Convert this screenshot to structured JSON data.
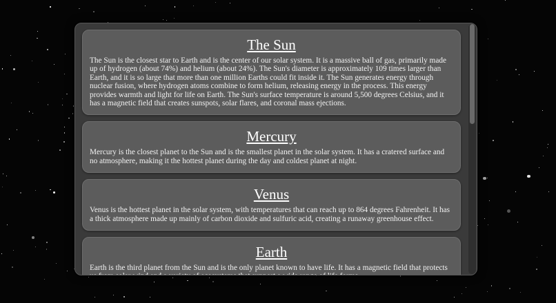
{
  "planets": [
    {
      "title": "The Sun",
      "description": "The Sun is the closest star to Earth and is the center of our solar system. It is a massive ball of gas, primarily made up of hydrogen (about 74%) and helium (about 24%). The Sun's diameter is approximately 109 times larger than Earth, and it is so large that more than one million Earths could fit inside it. The Sun generates energy through nuclear fusion, where hydrogen atoms combine to form helium, releasing energy in the process. This energy provides warmth and light for life on Earth. The Sun's surface temperature is around 5,500 degrees Celsius, and it has a magnetic field that creates sunspots, solar flares, and coronal mass ejections."
    },
    {
      "title": "Mercury",
      "description": "Mercury is the closest planet to the Sun and is the smallest planet in the solar system. It has a cratered surface and no atmosphere, making it the hottest planet during the day and coldest planet at night."
    },
    {
      "title": "Venus",
      "description": "Venus is the hottest planet in the solar system, with temperatures that can reach up to 864 degrees Fahrenheit. It has a thick atmosphere made up mainly of carbon dioxide and sulfuric acid, creating a runaway greenhouse effect."
    },
    {
      "title": "Earth",
      "description": "Earth is the third planet from the Sun and is the only planet known to have life. It has a magnetic field that protects us from solar wind and a variety of ecosystems that support a wide range of life forms."
    }
  ]
}
